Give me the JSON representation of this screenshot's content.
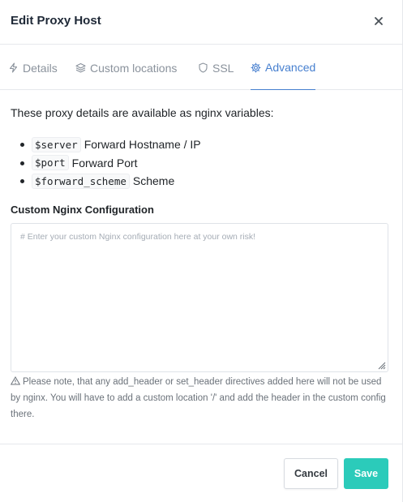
{
  "header": {
    "title": "Edit Proxy Host"
  },
  "tabs": [
    {
      "label": "Details",
      "icon": "lightning-icon"
    },
    {
      "label": "Custom locations",
      "icon": "layers-icon"
    },
    {
      "label": "SSL",
      "icon": "shield-icon"
    },
    {
      "label": "Advanced",
      "icon": "gear-icon",
      "active": true
    }
  ],
  "advanced": {
    "intro": "These proxy details are available as nginx variables:",
    "variables": [
      {
        "code": "$server",
        "desc": "Forward Hostname / IP"
      },
      {
        "code": "$port",
        "desc": "Forward Port"
      },
      {
        "code": "$forward_scheme",
        "desc": "Scheme"
      }
    ],
    "config_label": "Custom Nginx Configuration",
    "config_placeholder": "# Enter your custom Nginx configuration here at your own risk!",
    "config_value": "",
    "note": "Please note, that any add_header or set_header directives added here will not be used by nginx. You will have to add a custom location '/' and add the header in the custom config there."
  },
  "footer": {
    "cancel_label": "Cancel",
    "save_label": "Save"
  },
  "colors": {
    "accent": "#467fcf",
    "save": "#2bcbba",
    "muted": "#8a929c"
  }
}
